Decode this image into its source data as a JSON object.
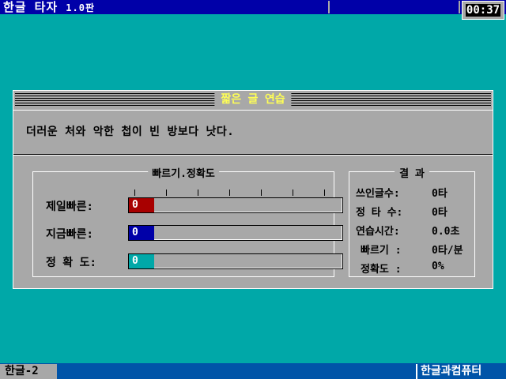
{
  "app": {
    "title": "한글 타자",
    "version": "1.0판"
  },
  "clock": "00:37",
  "panel": {
    "title": "짧은 글 연습",
    "sentence": "더러운 처와 악한 첩이 빈 방보다 낫다."
  },
  "speed": {
    "title": "빠르기.정확도",
    "rows": [
      {
        "label": "제일빠른:",
        "value": "0",
        "color": "#a80000"
      },
      {
        "label": "지금빠른:",
        "value": "0",
        "color": "#0000a8"
      },
      {
        "label": "정 확 도:",
        "value": "0",
        "color": "#00a8a8"
      }
    ]
  },
  "result": {
    "title": "결  과",
    "rows": [
      {
        "label": "쓰인글수:",
        "value": "0타"
      },
      {
        "label": "정 타 수:",
        "value": "0타"
      },
      {
        "label": "연습시간:",
        "value": "0.0초"
      },
      {
        "label": "빠르기 :",
        "value": "0타/분"
      },
      {
        "label": "정확도 :",
        "value": "0%"
      }
    ]
  },
  "status": {
    "ime": "한글-2",
    "brand": "한글과컴퓨터"
  }
}
